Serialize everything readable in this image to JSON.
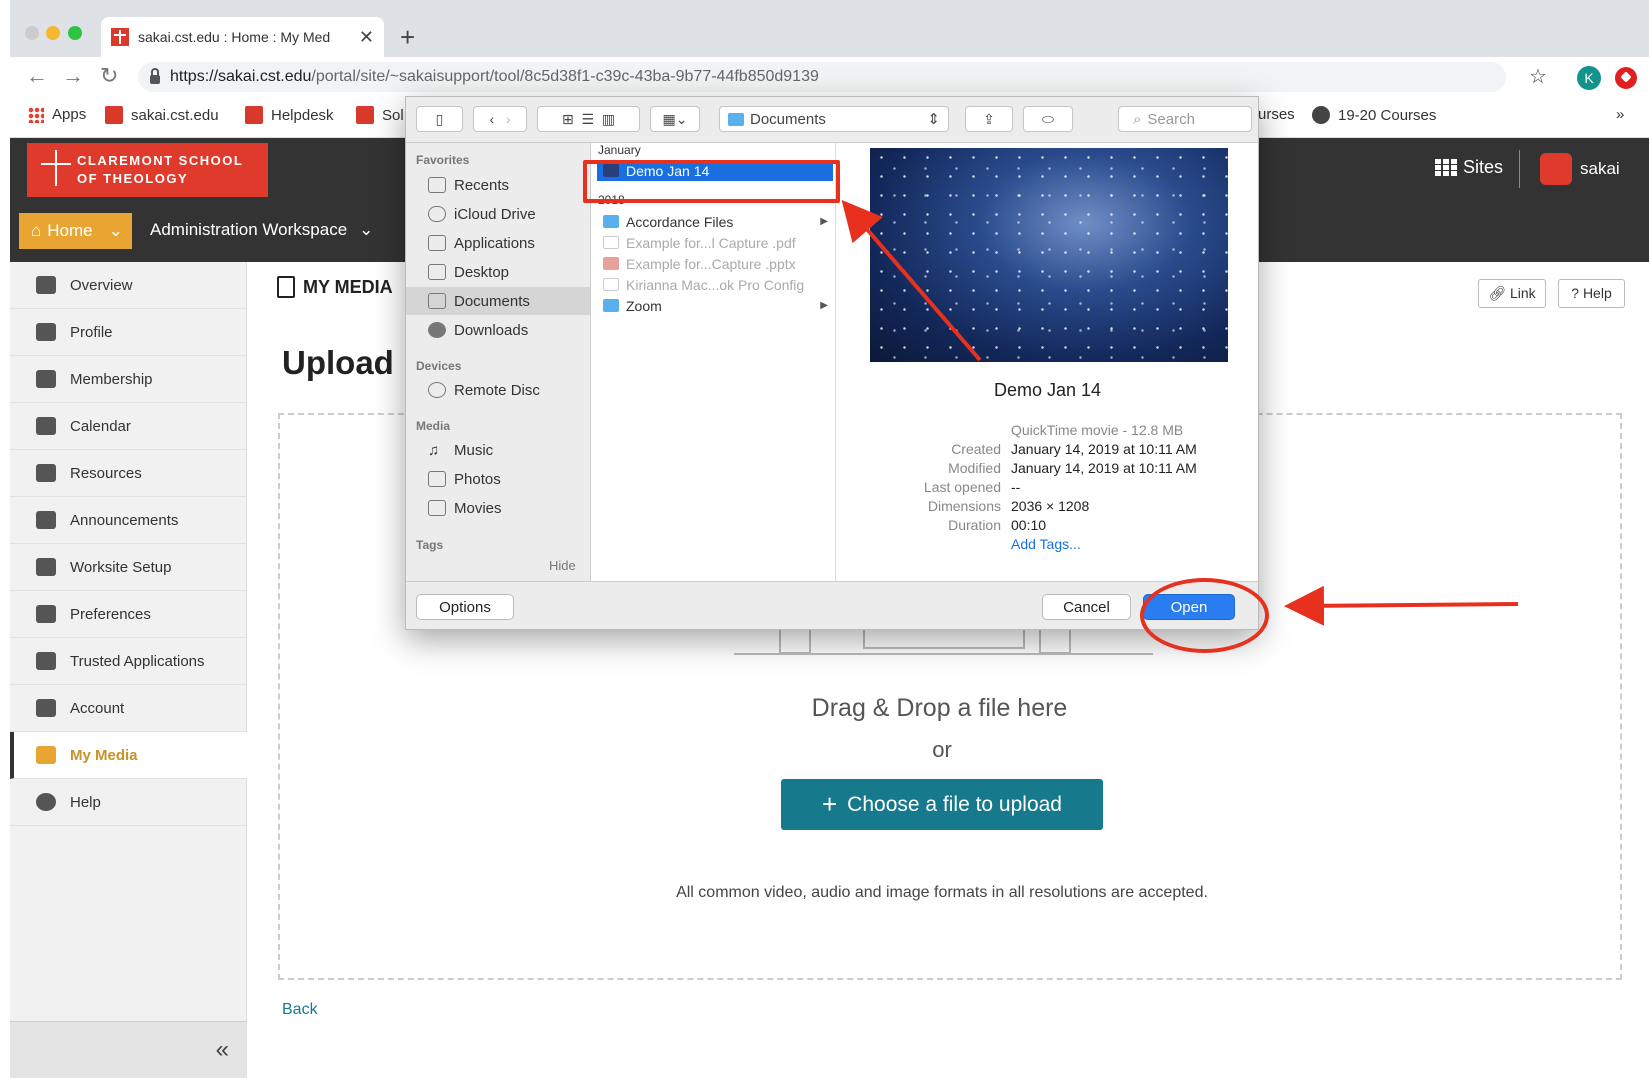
{
  "browser": {
    "tab_title": "sakai.cst.edu : Home : My Med",
    "tab_close": "✕",
    "new_tab": "+",
    "url_domain": "https://sakai.cst.edu",
    "url_path": "/portal/site/~sakaisupport/tool/8c5d38f1-c39c-43ba-9b77-44fb850d9139",
    "profile_initial": "K",
    "bookmarks": [
      {
        "label": "Apps"
      },
      {
        "label": "sakai.cst.edu"
      },
      {
        "label": "Helpdesk"
      },
      {
        "label": "Sol"
      },
      {
        "label": "urses"
      },
      {
        "label": "19-20 Courses"
      }
    ],
    "more": "»"
  },
  "sakai": {
    "logo_line1": "CLAREMONT SCHOOL",
    "logo_line2": "OF THEOLOGY",
    "sites_label": "Sites",
    "user_label": "sakai",
    "home_label": "Home",
    "workspace_label": "Administration Workspace"
  },
  "leftnav": {
    "items": [
      {
        "label": "Overview"
      },
      {
        "label": "Profile"
      },
      {
        "label": "Membership"
      },
      {
        "label": "Calendar"
      },
      {
        "label": "Resources"
      },
      {
        "label": "Announcements"
      },
      {
        "label": "Worksite Setup"
      },
      {
        "label": "Preferences"
      },
      {
        "label": "Trusted Applications"
      },
      {
        "label": "Account"
      },
      {
        "label": "My Media"
      },
      {
        "label": "Help"
      }
    ],
    "active_index": 10,
    "collapse_glyph": "«"
  },
  "main": {
    "tool_title": "MY MEDIA",
    "link_label": "Link",
    "help_label": "Help",
    "heading": "Upload M",
    "drag_text": "Drag & Drop a file here",
    "or_text": "or",
    "choose_button": "Choose a file to upload",
    "formats_text": "All common video, audio and image formats in all resolutions are accepted.",
    "back_link": "Back"
  },
  "dialog": {
    "location": "Documents",
    "search_placeholder": "Search",
    "sidebar": {
      "favorites_head": "Favorites",
      "favorites": [
        "Recents",
        "iCloud Drive",
        "Applications",
        "Desktop",
        "Documents",
        "Downloads"
      ],
      "selected": "Documents",
      "devices_head": "Devices",
      "devices": [
        "Remote Disc"
      ],
      "media_head": "Media",
      "media": [
        "Music",
        "Photos",
        "Movies"
      ],
      "tags_head": "Tags",
      "hide_label": "Hide"
    },
    "column": {
      "section1": "January",
      "section1_files": [
        "Demo Jan 14"
      ],
      "section2": "2018",
      "section2_files": [
        {
          "name": "Accordance Files",
          "kind": "folder",
          "dim": false
        },
        {
          "name": "Example for...l Capture .pdf",
          "kind": "file",
          "dim": true
        },
        {
          "name": "Example for...Capture .pptx",
          "kind": "file",
          "dim": true
        },
        {
          "name": "Kirianna Mac...ok Pro Config",
          "kind": "file",
          "dim": true
        },
        {
          "name": "Zoom",
          "kind": "folder",
          "dim": false
        }
      ]
    },
    "preview": {
      "name": "Demo Jan 14",
      "kind": "QuickTime movie - 12.8 MB",
      "created_label": "Created",
      "created": "January 14, 2019 at 10:11 AM",
      "modified_label": "Modified",
      "modified": "January 14, 2019 at 10:11 AM",
      "last_opened_label": "Last opened",
      "last_opened": "--",
      "dimensions_label": "Dimensions",
      "dimensions": "2036 × 1208",
      "duration_label": "Duration",
      "duration": "00:10",
      "add_tags": "Add Tags..."
    },
    "options_label": "Options",
    "cancel_label": "Cancel",
    "open_label": "Open"
  },
  "colors": {
    "sakai_red": "#e03a2c",
    "home_orange": "#e8a531",
    "teal": "#167a8c",
    "mac_blue": "#1a6fe0",
    "annotation_red": "#e8301f"
  }
}
